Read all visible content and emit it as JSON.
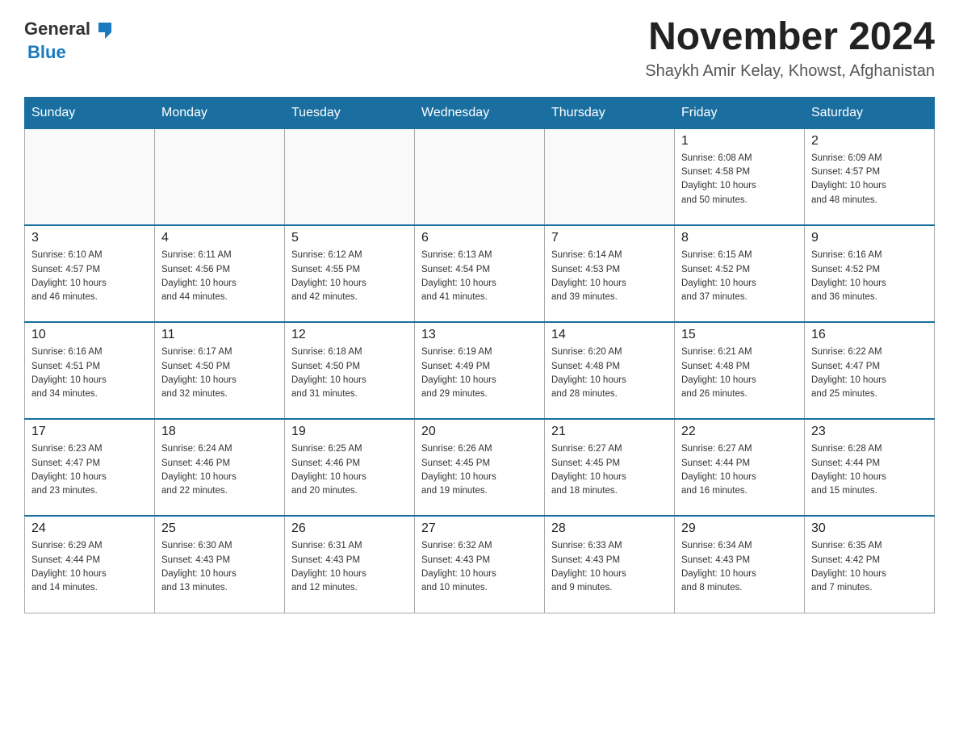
{
  "header": {
    "logo": {
      "general": "General",
      "blue": "Blue",
      "arrow_color": "#1a7abf"
    },
    "title": "November 2024",
    "subtitle": "Shaykh Amir Kelay, Khowst, Afghanistan"
  },
  "calendar": {
    "days_of_week": [
      "Sunday",
      "Monday",
      "Tuesday",
      "Wednesday",
      "Thursday",
      "Friday",
      "Saturday"
    ],
    "weeks": [
      [
        {
          "day": "",
          "info": ""
        },
        {
          "day": "",
          "info": ""
        },
        {
          "day": "",
          "info": ""
        },
        {
          "day": "",
          "info": ""
        },
        {
          "day": "",
          "info": ""
        },
        {
          "day": "1",
          "info": "Sunrise: 6:08 AM\nSunset: 4:58 PM\nDaylight: 10 hours\nand 50 minutes."
        },
        {
          "day": "2",
          "info": "Sunrise: 6:09 AM\nSunset: 4:57 PM\nDaylight: 10 hours\nand 48 minutes."
        }
      ],
      [
        {
          "day": "3",
          "info": "Sunrise: 6:10 AM\nSunset: 4:57 PM\nDaylight: 10 hours\nand 46 minutes."
        },
        {
          "day": "4",
          "info": "Sunrise: 6:11 AM\nSunset: 4:56 PM\nDaylight: 10 hours\nand 44 minutes."
        },
        {
          "day": "5",
          "info": "Sunrise: 6:12 AM\nSunset: 4:55 PM\nDaylight: 10 hours\nand 42 minutes."
        },
        {
          "day": "6",
          "info": "Sunrise: 6:13 AM\nSunset: 4:54 PM\nDaylight: 10 hours\nand 41 minutes."
        },
        {
          "day": "7",
          "info": "Sunrise: 6:14 AM\nSunset: 4:53 PM\nDaylight: 10 hours\nand 39 minutes."
        },
        {
          "day": "8",
          "info": "Sunrise: 6:15 AM\nSunset: 4:52 PM\nDaylight: 10 hours\nand 37 minutes."
        },
        {
          "day": "9",
          "info": "Sunrise: 6:16 AM\nSunset: 4:52 PM\nDaylight: 10 hours\nand 36 minutes."
        }
      ],
      [
        {
          "day": "10",
          "info": "Sunrise: 6:16 AM\nSunset: 4:51 PM\nDaylight: 10 hours\nand 34 minutes."
        },
        {
          "day": "11",
          "info": "Sunrise: 6:17 AM\nSunset: 4:50 PM\nDaylight: 10 hours\nand 32 minutes."
        },
        {
          "day": "12",
          "info": "Sunrise: 6:18 AM\nSunset: 4:50 PM\nDaylight: 10 hours\nand 31 minutes."
        },
        {
          "day": "13",
          "info": "Sunrise: 6:19 AM\nSunset: 4:49 PM\nDaylight: 10 hours\nand 29 minutes."
        },
        {
          "day": "14",
          "info": "Sunrise: 6:20 AM\nSunset: 4:48 PM\nDaylight: 10 hours\nand 28 minutes."
        },
        {
          "day": "15",
          "info": "Sunrise: 6:21 AM\nSunset: 4:48 PM\nDaylight: 10 hours\nand 26 minutes."
        },
        {
          "day": "16",
          "info": "Sunrise: 6:22 AM\nSunset: 4:47 PM\nDaylight: 10 hours\nand 25 minutes."
        }
      ],
      [
        {
          "day": "17",
          "info": "Sunrise: 6:23 AM\nSunset: 4:47 PM\nDaylight: 10 hours\nand 23 minutes."
        },
        {
          "day": "18",
          "info": "Sunrise: 6:24 AM\nSunset: 4:46 PM\nDaylight: 10 hours\nand 22 minutes."
        },
        {
          "day": "19",
          "info": "Sunrise: 6:25 AM\nSunset: 4:46 PM\nDaylight: 10 hours\nand 20 minutes."
        },
        {
          "day": "20",
          "info": "Sunrise: 6:26 AM\nSunset: 4:45 PM\nDaylight: 10 hours\nand 19 minutes."
        },
        {
          "day": "21",
          "info": "Sunrise: 6:27 AM\nSunset: 4:45 PM\nDaylight: 10 hours\nand 18 minutes."
        },
        {
          "day": "22",
          "info": "Sunrise: 6:27 AM\nSunset: 4:44 PM\nDaylight: 10 hours\nand 16 minutes."
        },
        {
          "day": "23",
          "info": "Sunrise: 6:28 AM\nSunset: 4:44 PM\nDaylight: 10 hours\nand 15 minutes."
        }
      ],
      [
        {
          "day": "24",
          "info": "Sunrise: 6:29 AM\nSunset: 4:44 PM\nDaylight: 10 hours\nand 14 minutes."
        },
        {
          "day": "25",
          "info": "Sunrise: 6:30 AM\nSunset: 4:43 PM\nDaylight: 10 hours\nand 13 minutes."
        },
        {
          "day": "26",
          "info": "Sunrise: 6:31 AM\nSunset: 4:43 PM\nDaylight: 10 hours\nand 12 minutes."
        },
        {
          "day": "27",
          "info": "Sunrise: 6:32 AM\nSunset: 4:43 PM\nDaylight: 10 hours\nand 10 minutes."
        },
        {
          "day": "28",
          "info": "Sunrise: 6:33 AM\nSunset: 4:43 PM\nDaylight: 10 hours\nand 9 minutes."
        },
        {
          "day": "29",
          "info": "Sunrise: 6:34 AM\nSunset: 4:43 PM\nDaylight: 10 hours\nand 8 minutes."
        },
        {
          "day": "30",
          "info": "Sunrise: 6:35 AM\nSunset: 4:42 PM\nDaylight: 10 hours\nand 7 minutes."
        }
      ]
    ]
  }
}
